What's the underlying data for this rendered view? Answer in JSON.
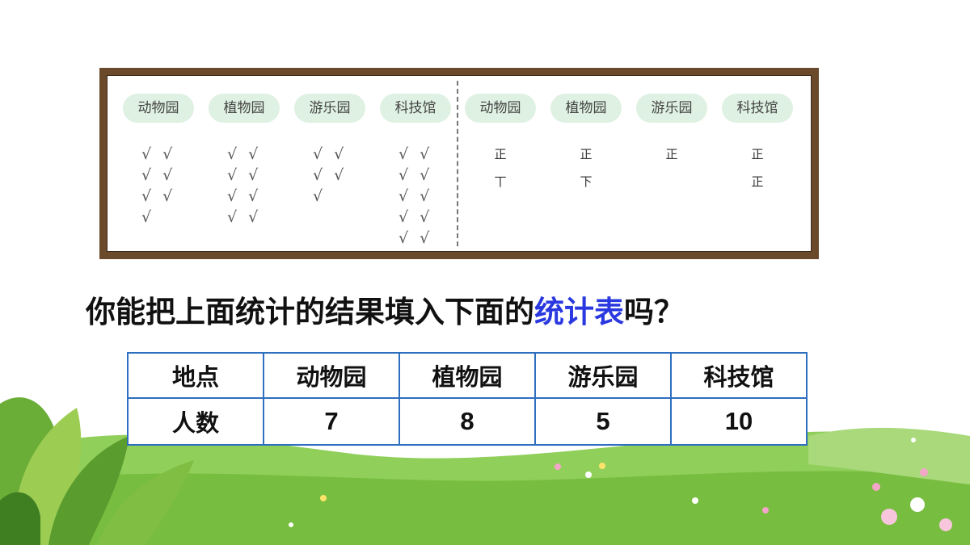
{
  "board": {
    "left_tags": [
      "动物园",
      "植物园",
      "游乐园",
      "科技馆"
    ],
    "right_tags": [
      "动物园",
      "植物园",
      "游乐园",
      "科技馆"
    ],
    "tick_columns": [
      [
        "√ √",
        "√ √",
        "√ √",
        "√"
      ],
      [
        "√ √",
        "√ √",
        "√ √",
        "√ √"
      ],
      [
        "√ √",
        "√ √",
        "√"
      ],
      [
        "√ √",
        "√ √",
        "√ √",
        "√ √",
        "√ √"
      ]
    ],
    "tally_columns": [
      [
        "正",
        "丅"
      ],
      [
        "正",
        "下"
      ],
      [
        "正"
      ],
      [
        "正",
        "正"
      ]
    ]
  },
  "question": {
    "before": "你能把上面统计的结果填入下面的",
    "highlight": "统计表",
    "after": "吗？",
    "highlight_color": "#2a38e0"
  },
  "table": {
    "header_label": "地点",
    "row_label": "人数",
    "places": [
      "动物园",
      "植物园",
      "游乐园",
      "科技馆"
    ],
    "counts": [
      "7",
      "8",
      "5",
      "10"
    ],
    "border_color": "#2f6fc0"
  }
}
